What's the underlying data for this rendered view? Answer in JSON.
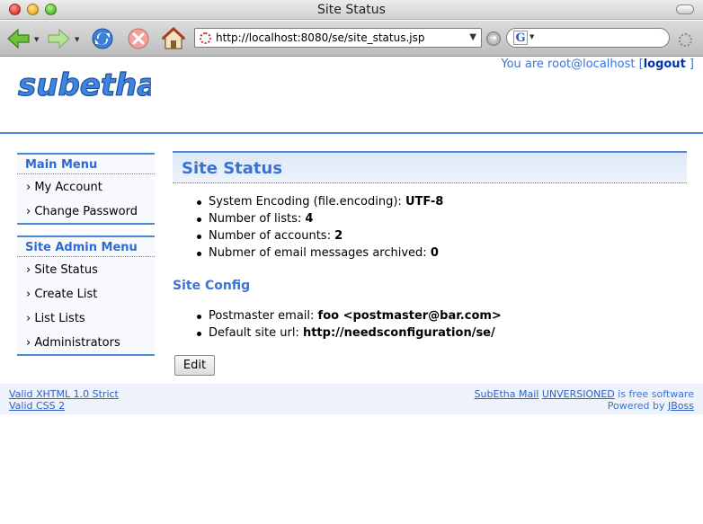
{
  "window": {
    "title": "Site Status"
  },
  "browser": {
    "url": "http://localhost:8080/se/site_status.jsp",
    "search_value": ""
  },
  "header": {
    "logo_text": "subetha",
    "user_prefix": "You are root@localhost [",
    "logout_label": "logout",
    "user_suffix": " ]"
  },
  "sidebar": {
    "main_menu_title": "Main Menu",
    "main_items": [
      {
        "label": "› My Account"
      },
      {
        "label": "› Change Password"
      }
    ],
    "admin_menu_title": "Site Admin Menu",
    "admin_items": [
      {
        "label": "› Site Status"
      },
      {
        "label": "› Create List"
      },
      {
        "label": "› List Lists"
      },
      {
        "label": "› Administrators"
      }
    ]
  },
  "main": {
    "title": "Site Status",
    "status_facts": [
      {
        "label": "System Encoding (file.encoding): ",
        "value": "UTF-8"
      },
      {
        "label": "Number of lists: ",
        "value": "4"
      },
      {
        "label": "Number of accounts: ",
        "value": "2"
      },
      {
        "label": "Nubmer of email messages archived: ",
        "value": "0"
      }
    ],
    "config_title": "Site Config",
    "config_facts": [
      {
        "label": "Postmaster email: ",
        "value": "foo <postmaster@bar.com>"
      },
      {
        "label": "Default site url: ",
        "value": "http://needsconfiguration/se/"
      }
    ],
    "edit_label": "Edit"
  },
  "footer": {
    "valid_xhtml": "Valid XHTML 1.0 Strict",
    "valid_css": "Valid CSS 2",
    "product_link": "SubEtha Mail",
    "version_link": "UNVERSIONED",
    "free_text": " is free software",
    "powered_text": "Powered by ",
    "jboss_link": "JBoss"
  },
  "colors": {
    "accent": "#3a73d6",
    "rule": "#4a8ad8",
    "panel": "#eef3fb"
  }
}
